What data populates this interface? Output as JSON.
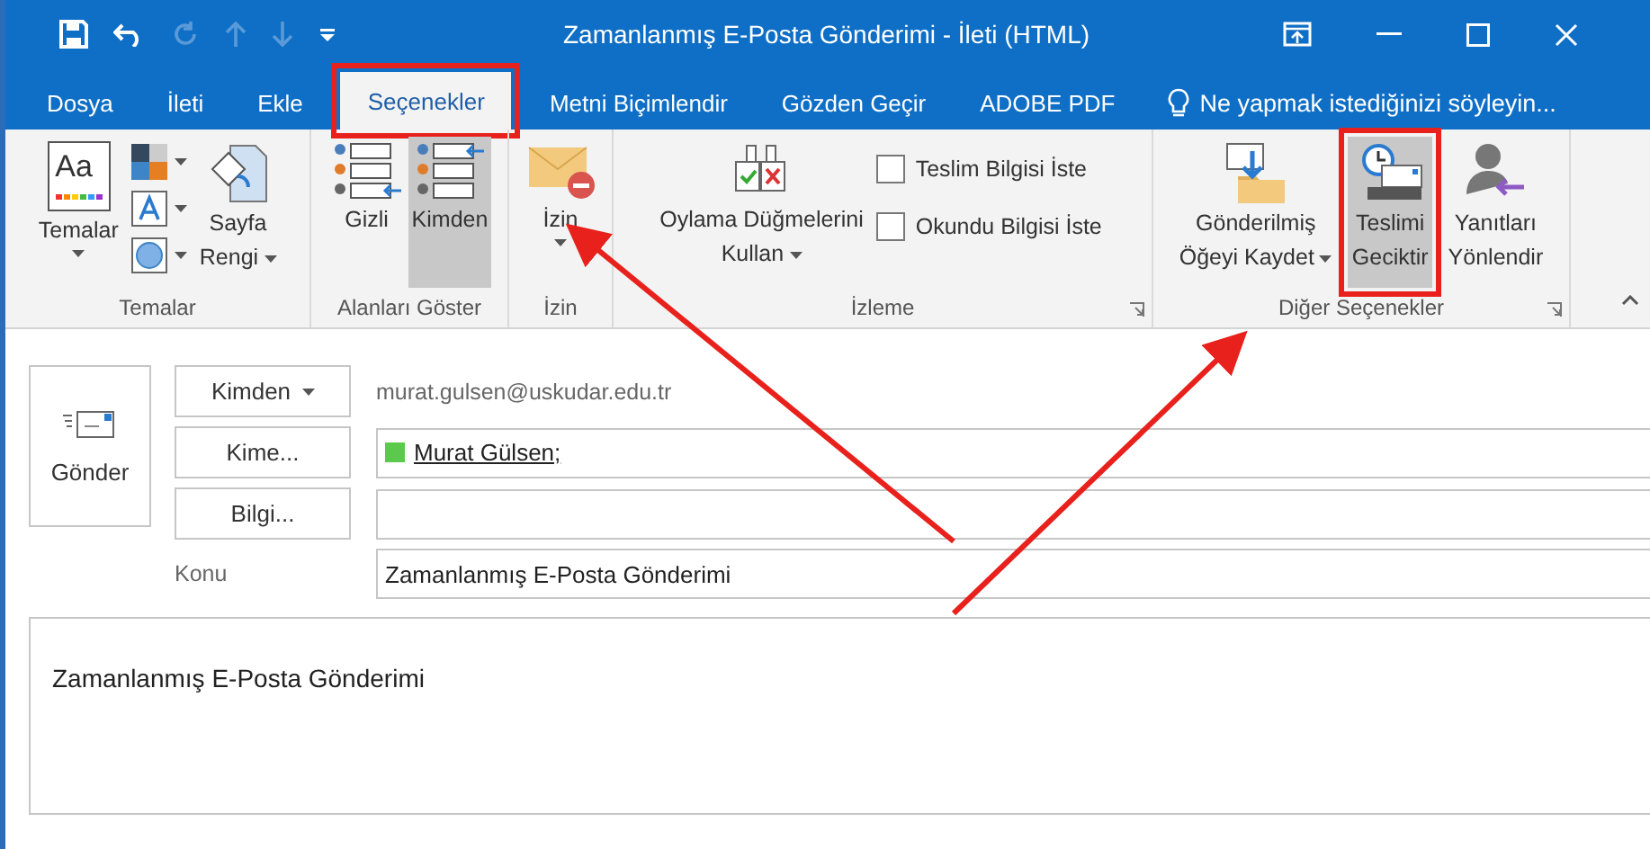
{
  "window": {
    "title": "Zamanlanmış E-Posta Gönderimi - İleti (HTML)"
  },
  "tabs": [
    {
      "label": "Dosya",
      "selected": false,
      "highlighted": false
    },
    {
      "label": "İleti",
      "selected": false,
      "highlighted": false
    },
    {
      "label": "Ekle",
      "selected": false,
      "highlighted": false
    },
    {
      "label": "Seçenekler",
      "selected": true,
      "highlighted": true
    },
    {
      "label": "Metni Biçimlendir",
      "selected": false,
      "highlighted": false
    },
    {
      "label": "Gözden Geçir",
      "selected": false,
      "highlighted": false
    },
    {
      "label": "ADOBE PDF",
      "selected": false,
      "highlighted": false
    }
  ],
  "tell_me": "Ne yapmak istediğinizi söyleyin...",
  "ribbon_groups": [
    {
      "label": "Temalar",
      "items": [
        {
          "kind": "large",
          "icon_text": "Aa",
          "lines": [
            "Temalar"
          ],
          "has_menu": true,
          "pressed": false,
          "highlighted": false
        },
        {
          "kind": "swatches"
        },
        {
          "kind": "large",
          "lines": [
            "Sayfa",
            "Rengi"
          ],
          "has_menu": true,
          "pressed": false,
          "highlighted": false
        }
      ]
    },
    {
      "label": "Alanları Göster",
      "items": [
        {
          "kind": "large",
          "lines": [
            "Gizli"
          ],
          "has_menu": false,
          "pressed": false,
          "highlighted": false
        },
        {
          "kind": "large",
          "lines": [
            "Kimden"
          ],
          "has_menu": false,
          "pressed": true,
          "highlighted": false
        }
      ]
    },
    {
      "label": "İzin",
      "items": [
        {
          "kind": "large",
          "lines": [
            "İzin"
          ],
          "has_menu": true,
          "pressed": false,
          "highlighted": false
        }
      ]
    },
    {
      "label": "İzleme",
      "launcher": true,
      "items": [
        {
          "kind": "large",
          "lines": [
            "Oylama Düğmelerini",
            "Kullan"
          ],
          "has_menu": true,
          "pressed": false,
          "highlighted": false
        },
        {
          "kind": "checks",
          "options": [
            {
              "label": "Teslim Bilgisi İste",
              "checked": false
            },
            {
              "label": "Okundu Bilgisi İste",
              "checked": false
            }
          ]
        }
      ]
    },
    {
      "label": "Diğer Seçenekler",
      "launcher": true,
      "items": [
        {
          "kind": "large",
          "lines": [
            "Gönderilmiş",
            "Öğeyi Kaydet"
          ],
          "has_menu": true,
          "pressed": false,
          "highlighted": false
        },
        {
          "kind": "large",
          "lines": [
            "Teslimi",
            "Geciktir"
          ],
          "has_menu": false,
          "pressed": true,
          "highlighted": true
        },
        {
          "kind": "large",
          "lines": [
            "Yanıtları",
            "Yönlendir"
          ],
          "has_menu": false,
          "pressed": false,
          "highlighted": false
        }
      ]
    }
  ],
  "compose": {
    "send": "Gönder",
    "from_button": "Kimden",
    "from_value": "murat.gulsen@uskudar.edu.tr",
    "to_button": "Kime...",
    "to_value": "Murat Gülsen;",
    "cc_button": "Bilgi...",
    "subject_label": "Konu",
    "subject_value": "Zamanlanmış E-Posta Gönderimi",
    "body": "Zamanlanmış E-Posta Gönderimi"
  }
}
